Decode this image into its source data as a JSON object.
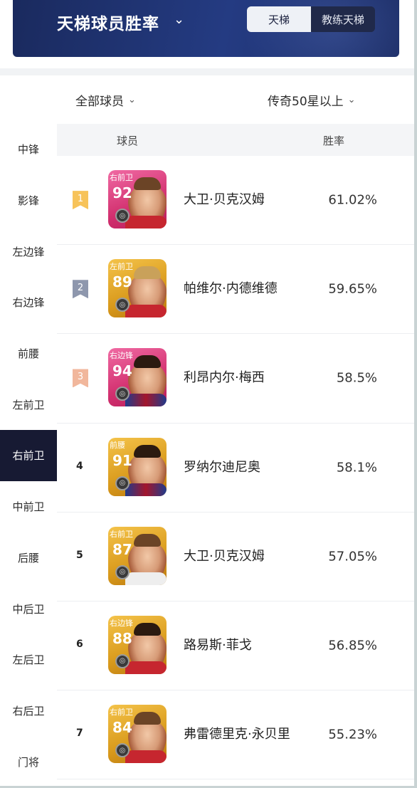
{
  "header": {
    "title": "天梯球员胜率",
    "tabs": [
      {
        "label": "天梯",
        "active": true
      },
      {
        "label": "教练天梯",
        "active": false
      }
    ]
  },
  "filters": {
    "players": "全部球员",
    "tier": "传奇50星以上"
  },
  "sidebar": {
    "items": [
      "中锋",
      "影锋",
      "左边锋",
      "右边锋",
      "前腰",
      "左前卫",
      "右前卫",
      "中前卫",
      "后腰",
      "中后卫",
      "左后卫",
      "右后卫",
      "门将"
    ],
    "active_index": 6
  },
  "table": {
    "headers": {
      "player": "球员",
      "win_rate": "胜率"
    },
    "rows": [
      {
        "rank": "1",
        "position": "右前卫",
        "rating": "92",
        "name": "大卫·贝克汉姆",
        "win_rate": "61.02%",
        "card_color": "pink"
      },
      {
        "rank": "2",
        "position": "左前卫",
        "rating": "89",
        "name": "帕维尔·内德维德",
        "win_rate": "59.65%",
        "card_color": "gold"
      },
      {
        "rank": "3",
        "position": "右边锋",
        "rating": "94",
        "name": "利昂内尔·梅西",
        "win_rate": "58.5%",
        "card_color": "pink"
      },
      {
        "rank": "4",
        "position": "前腰",
        "rating": "91",
        "name": "罗纳尔迪尼奥",
        "win_rate": "58.1%",
        "card_color": "gold"
      },
      {
        "rank": "5",
        "position": "右前卫",
        "rating": "87",
        "name": "大卫·贝克汉姆",
        "win_rate": "57.05%",
        "card_color": "gold"
      },
      {
        "rank": "6",
        "position": "右边锋",
        "rating": "88",
        "name": "路易斯·菲戈",
        "win_rate": "56.85%",
        "card_color": "gold"
      },
      {
        "rank": "7",
        "position": "右前卫",
        "rating": "84",
        "name": "弗雷德里克·永贝里",
        "win_rate": "55.23%",
        "card_color": "gold"
      }
    ]
  },
  "colors": {
    "rank1": "#f7c35a",
    "rank2": "#8e97ad",
    "rank3": "#f1b79c",
    "active_sidebar": "#171a33"
  }
}
